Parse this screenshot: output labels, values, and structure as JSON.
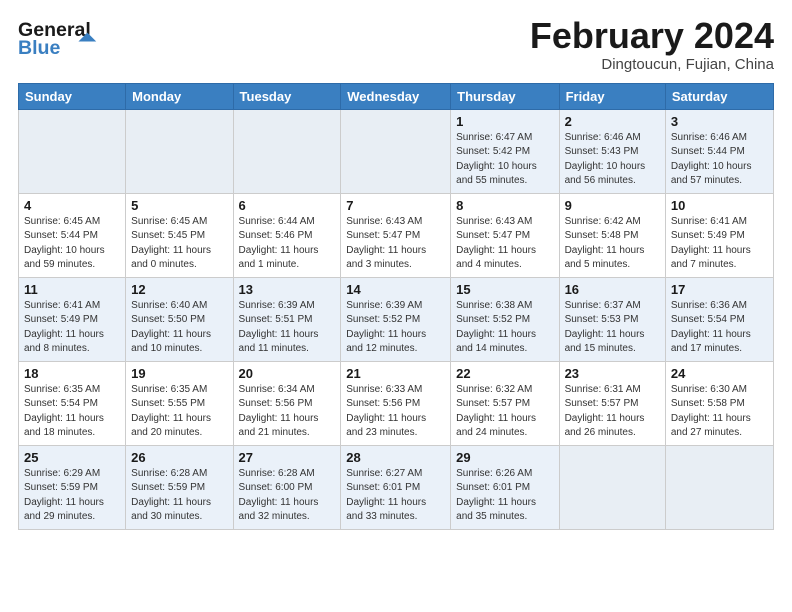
{
  "header": {
    "logo_line1": "General",
    "logo_line2": "Blue",
    "month_title": "February 2024",
    "location": "Dingtoucun, Fujian, China"
  },
  "weekdays": [
    "Sunday",
    "Monday",
    "Tuesday",
    "Wednesday",
    "Thursday",
    "Friday",
    "Saturday"
  ],
  "weeks": [
    [
      {
        "day": "",
        "info": ""
      },
      {
        "day": "",
        "info": ""
      },
      {
        "day": "",
        "info": ""
      },
      {
        "day": "",
        "info": ""
      },
      {
        "day": "1",
        "info": "Sunrise: 6:47 AM\nSunset: 5:42 PM\nDaylight: 10 hours\nand 55 minutes."
      },
      {
        "day": "2",
        "info": "Sunrise: 6:46 AM\nSunset: 5:43 PM\nDaylight: 10 hours\nand 56 minutes."
      },
      {
        "day": "3",
        "info": "Sunrise: 6:46 AM\nSunset: 5:44 PM\nDaylight: 10 hours\nand 57 minutes."
      }
    ],
    [
      {
        "day": "4",
        "info": "Sunrise: 6:45 AM\nSunset: 5:44 PM\nDaylight: 10 hours\nand 59 minutes."
      },
      {
        "day": "5",
        "info": "Sunrise: 6:45 AM\nSunset: 5:45 PM\nDaylight: 11 hours\nand 0 minutes."
      },
      {
        "day": "6",
        "info": "Sunrise: 6:44 AM\nSunset: 5:46 PM\nDaylight: 11 hours\nand 1 minute."
      },
      {
        "day": "7",
        "info": "Sunrise: 6:43 AM\nSunset: 5:47 PM\nDaylight: 11 hours\nand 3 minutes."
      },
      {
        "day": "8",
        "info": "Sunrise: 6:43 AM\nSunset: 5:47 PM\nDaylight: 11 hours\nand 4 minutes."
      },
      {
        "day": "9",
        "info": "Sunrise: 6:42 AM\nSunset: 5:48 PM\nDaylight: 11 hours\nand 5 minutes."
      },
      {
        "day": "10",
        "info": "Sunrise: 6:41 AM\nSunset: 5:49 PM\nDaylight: 11 hours\nand 7 minutes."
      }
    ],
    [
      {
        "day": "11",
        "info": "Sunrise: 6:41 AM\nSunset: 5:49 PM\nDaylight: 11 hours\nand 8 minutes."
      },
      {
        "day": "12",
        "info": "Sunrise: 6:40 AM\nSunset: 5:50 PM\nDaylight: 11 hours\nand 10 minutes."
      },
      {
        "day": "13",
        "info": "Sunrise: 6:39 AM\nSunset: 5:51 PM\nDaylight: 11 hours\nand 11 minutes."
      },
      {
        "day": "14",
        "info": "Sunrise: 6:39 AM\nSunset: 5:52 PM\nDaylight: 11 hours\nand 12 minutes."
      },
      {
        "day": "15",
        "info": "Sunrise: 6:38 AM\nSunset: 5:52 PM\nDaylight: 11 hours\nand 14 minutes."
      },
      {
        "day": "16",
        "info": "Sunrise: 6:37 AM\nSunset: 5:53 PM\nDaylight: 11 hours\nand 15 minutes."
      },
      {
        "day": "17",
        "info": "Sunrise: 6:36 AM\nSunset: 5:54 PM\nDaylight: 11 hours\nand 17 minutes."
      }
    ],
    [
      {
        "day": "18",
        "info": "Sunrise: 6:35 AM\nSunset: 5:54 PM\nDaylight: 11 hours\nand 18 minutes."
      },
      {
        "day": "19",
        "info": "Sunrise: 6:35 AM\nSunset: 5:55 PM\nDaylight: 11 hours\nand 20 minutes."
      },
      {
        "day": "20",
        "info": "Sunrise: 6:34 AM\nSunset: 5:56 PM\nDaylight: 11 hours\nand 21 minutes."
      },
      {
        "day": "21",
        "info": "Sunrise: 6:33 AM\nSunset: 5:56 PM\nDaylight: 11 hours\nand 23 minutes."
      },
      {
        "day": "22",
        "info": "Sunrise: 6:32 AM\nSunset: 5:57 PM\nDaylight: 11 hours\nand 24 minutes."
      },
      {
        "day": "23",
        "info": "Sunrise: 6:31 AM\nSunset: 5:57 PM\nDaylight: 11 hours\nand 26 minutes."
      },
      {
        "day": "24",
        "info": "Sunrise: 6:30 AM\nSunset: 5:58 PM\nDaylight: 11 hours\nand 27 minutes."
      }
    ],
    [
      {
        "day": "25",
        "info": "Sunrise: 6:29 AM\nSunset: 5:59 PM\nDaylight: 11 hours\nand 29 minutes."
      },
      {
        "day": "26",
        "info": "Sunrise: 6:28 AM\nSunset: 5:59 PM\nDaylight: 11 hours\nand 30 minutes."
      },
      {
        "day": "27",
        "info": "Sunrise: 6:28 AM\nSunset: 6:00 PM\nDaylight: 11 hours\nand 32 minutes."
      },
      {
        "day": "28",
        "info": "Sunrise: 6:27 AM\nSunset: 6:01 PM\nDaylight: 11 hours\nand 33 minutes."
      },
      {
        "day": "29",
        "info": "Sunrise: 6:26 AM\nSunset: 6:01 PM\nDaylight: 11 hours\nand 35 minutes."
      },
      {
        "day": "",
        "info": ""
      },
      {
        "day": "",
        "info": ""
      }
    ]
  ]
}
